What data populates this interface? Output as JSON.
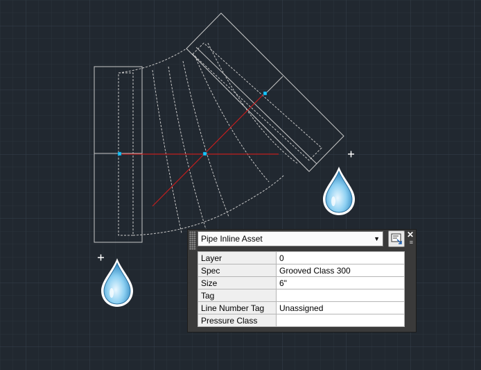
{
  "palette": {
    "selector_value": "Pipe Inline Asset",
    "dropdown_arrow": "▼",
    "close_label": "✕",
    "menu_label": "≡",
    "quick_select_icon": "quick-select-icon",
    "rows": [
      {
        "label": "Layer",
        "value": "0"
      },
      {
        "label": "Spec",
        "value": "Grooved Class 300"
      },
      {
        "label": "Size",
        "value": "6\""
      },
      {
        "label": "Tag",
        "value": ""
      },
      {
        "label": "Line Number Tag",
        "value": "Unassigned"
      },
      {
        "label": "Pressure Class",
        "value": ""
      }
    ]
  },
  "colors": {
    "background": "#212830",
    "geometry": "#c8c8c8",
    "centerline": "#c41e1e",
    "grip": "#19c8ff",
    "droplet": "#7ec8ec"
  },
  "icons": [
    "crosshair-cursor-icon",
    "water-droplet-icon"
  ]
}
